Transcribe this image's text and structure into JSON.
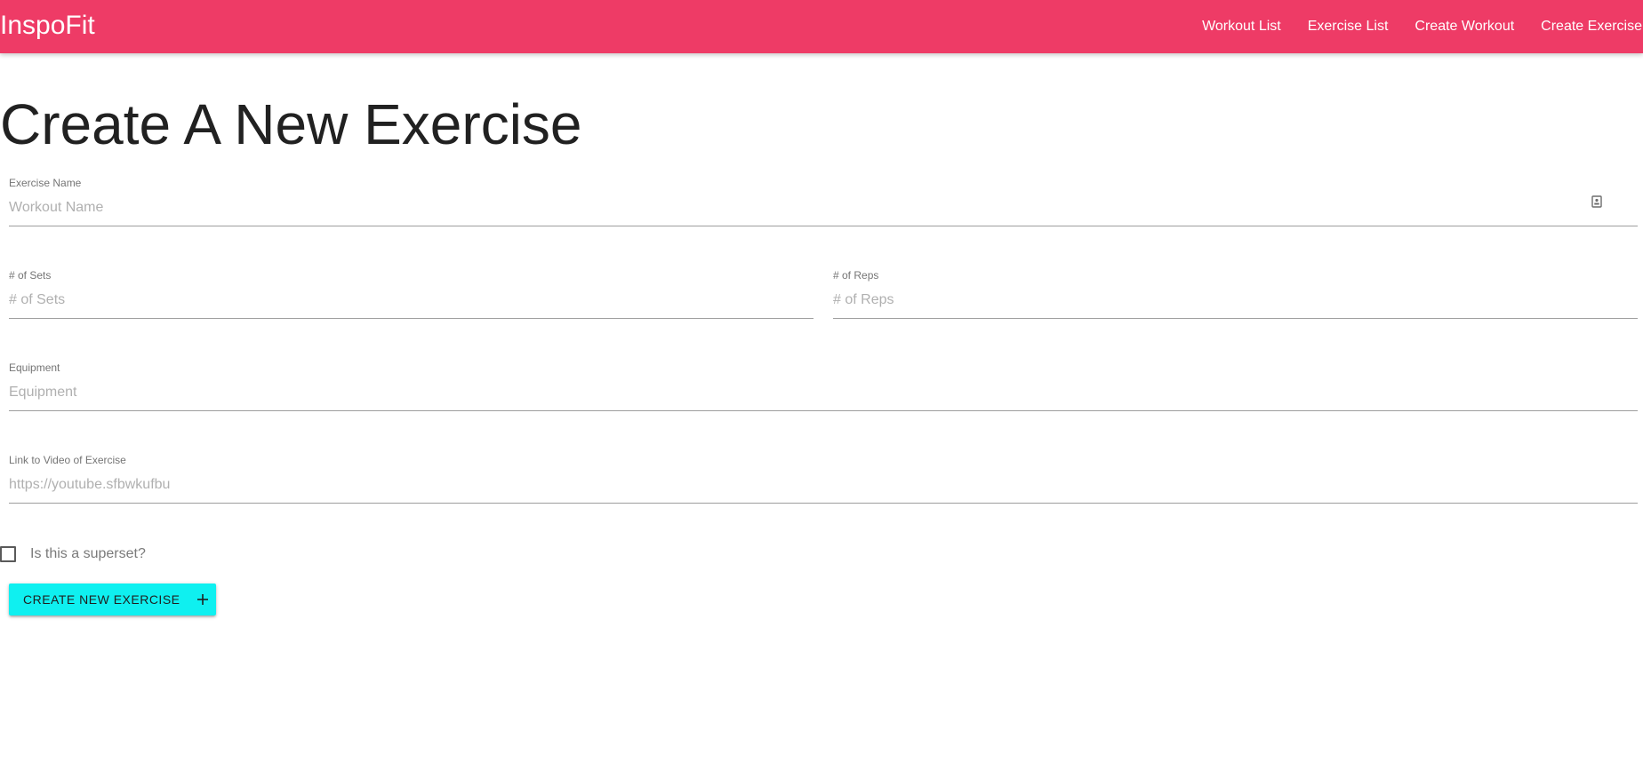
{
  "navbar": {
    "brand": "InspoFit",
    "links": [
      "Workout List",
      "Exercise List",
      "Create Workout",
      "Create Exercise"
    ],
    "background_color": "#ee3b66"
  },
  "page": {
    "title": "Create A New Exercise"
  },
  "form": {
    "exercise_name": {
      "label": "Exercise Name",
      "placeholder": "Workout Name",
      "value": "",
      "icon": "id-badge-icon"
    },
    "sets": {
      "label": "# of Sets",
      "placeholder": "# of Sets",
      "value": ""
    },
    "reps": {
      "label": "# of Reps",
      "placeholder": "# of Reps",
      "value": ""
    },
    "equipment": {
      "label": "Equipment",
      "placeholder": "Equipment",
      "value": ""
    },
    "video_link": {
      "label": "Link to Video of Exercise",
      "placeholder": "https://youtube.sfbwkufbu",
      "value": ""
    },
    "superset": {
      "label": "Is this a superset?",
      "checked": false
    },
    "submit": {
      "label": "Create New Exercise",
      "icon": "plus-icon",
      "color": "#0ff0f0"
    }
  }
}
